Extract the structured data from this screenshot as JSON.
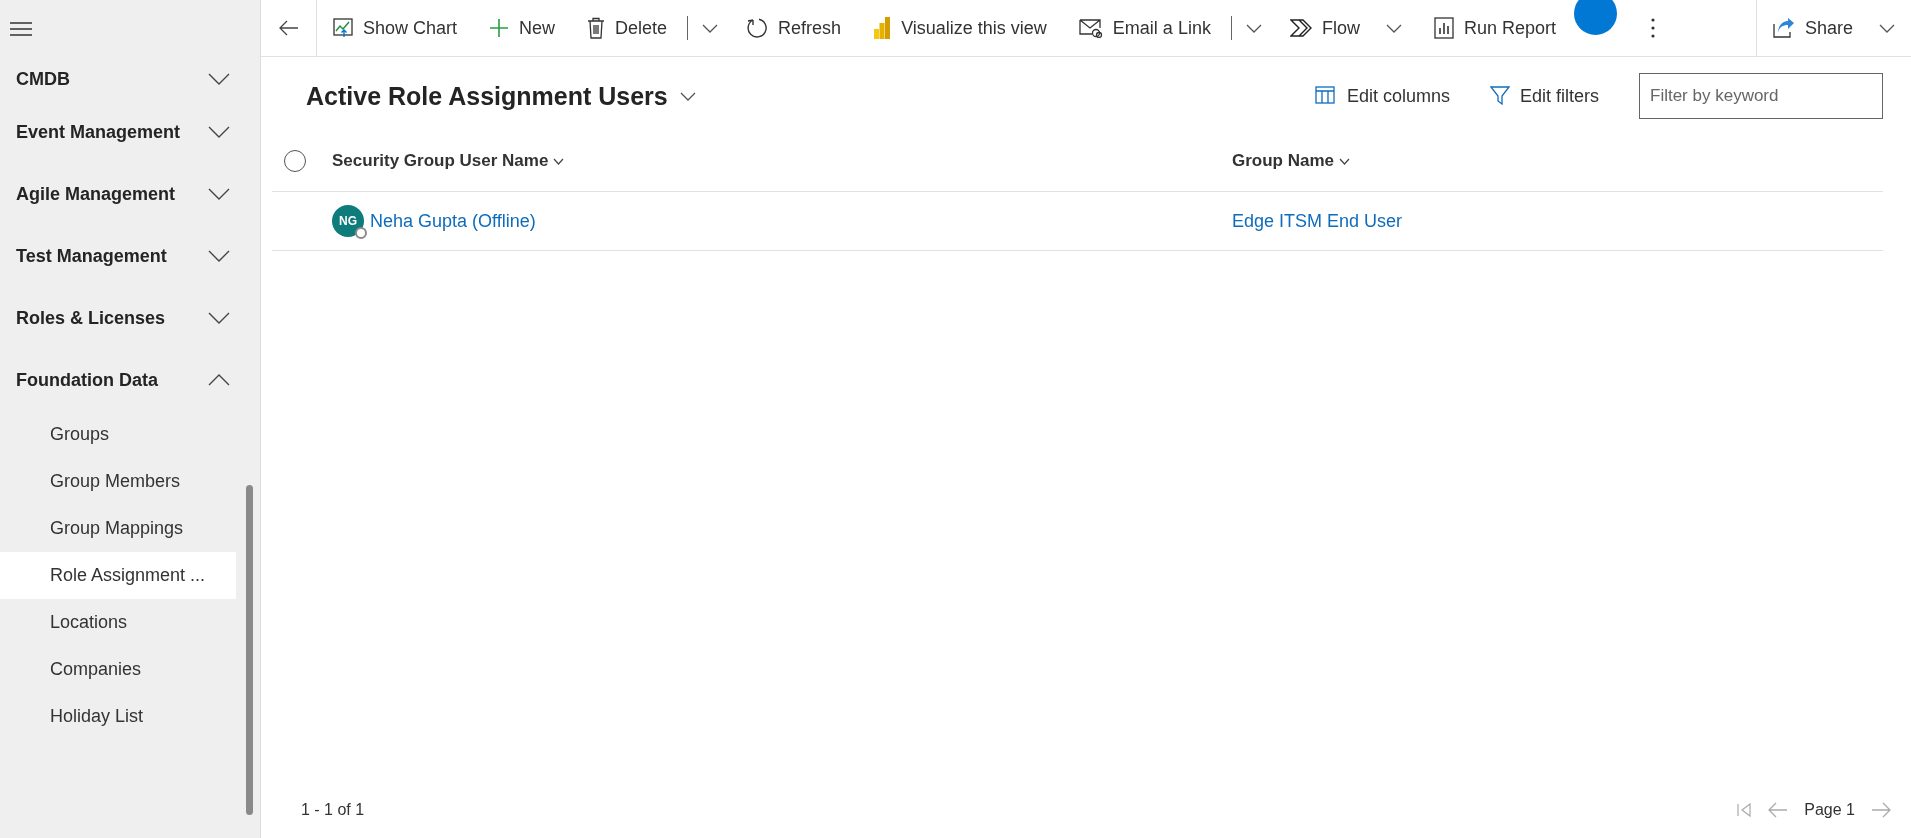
{
  "sidebar": {
    "groups": [
      {
        "label": "CMDB",
        "expanded": false
      },
      {
        "label": "Event Management",
        "expanded": false
      },
      {
        "label": "Agile Management",
        "expanded": false
      },
      {
        "label": "Test Management",
        "expanded": false
      },
      {
        "label": "Roles & Licenses",
        "expanded": false
      },
      {
        "label": "Foundation Data",
        "expanded": true,
        "items": [
          {
            "label": "Groups",
            "selected": false
          },
          {
            "label": "Group Members",
            "selected": false
          },
          {
            "label": "Group Mappings",
            "selected": false
          },
          {
            "label": "Role Assignment ...",
            "selected": true
          },
          {
            "label": "Locations",
            "selected": false
          },
          {
            "label": "Companies",
            "selected": false
          },
          {
            "label": "Holiday List",
            "selected": false
          }
        ]
      }
    ]
  },
  "toolbar": {
    "items": [
      {
        "kind": "button",
        "label": "Show Chart"
      },
      {
        "kind": "button",
        "label": "New"
      },
      {
        "kind": "split",
        "label": "Delete"
      },
      {
        "kind": "button",
        "label": "Refresh"
      },
      {
        "kind": "button",
        "label": "Visualize this view"
      },
      {
        "kind": "split",
        "label": "Email a Link"
      },
      {
        "kind": "dropdown",
        "label": "Flow"
      },
      {
        "kind": "button",
        "label": "Run Report"
      }
    ],
    "share": {
      "label": "Share"
    }
  },
  "view": {
    "title": "Active Role Assignment Users",
    "edit_columns": "Edit columns",
    "edit_filters": "Edit filters",
    "filter": {
      "placeholder": "Filter by keyword"
    }
  },
  "table": {
    "all_selected": false,
    "columns": [
      "Security Group User Name",
      "Group Name"
    ],
    "rows": [
      {
        "initials": "NG",
        "user": "Neha Gupta (Offline)",
        "group": "Edge ITSM End User"
      }
    ]
  },
  "footer": {
    "count": "1 - 1 of 1",
    "page": "Page 1"
  }
}
